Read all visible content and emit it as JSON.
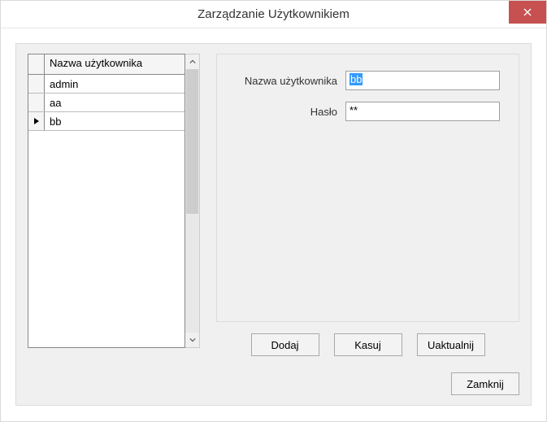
{
  "window": {
    "title": "Zarządzanie Użytkownikiem"
  },
  "grid": {
    "column_header": "Nazwa użytkownika",
    "rows": [
      {
        "name": "admin",
        "current": false
      },
      {
        "name": "aa",
        "current": false
      },
      {
        "name": "bb",
        "current": true
      }
    ]
  },
  "form": {
    "username_label": "Nazwa użytkownika",
    "username_value": "bb",
    "password_label": "Hasło",
    "password_value": "**"
  },
  "buttons": {
    "add": "Dodaj",
    "delete": "Kasuj",
    "update": "Uaktualnij",
    "close": "Zamknij"
  }
}
